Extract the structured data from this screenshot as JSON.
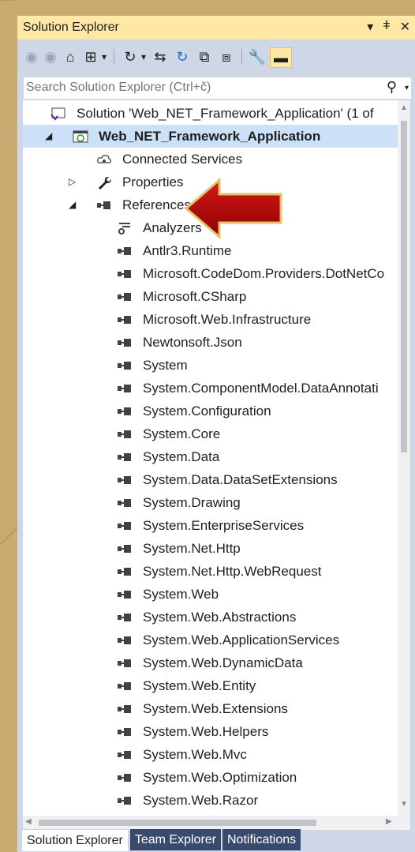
{
  "panel": {
    "title": "Solution Explorer",
    "pin_glyph": "▾",
    "autohide_glyph": "ǂ",
    "close_glyph": "✕"
  },
  "toolbar": {
    "back_glyph": "◉",
    "forward_glyph": "◉",
    "home_glyph": "⌂",
    "switch_views_glyph": "⊞",
    "dropdown_glyph": "▾",
    "history_glyph": "↻",
    "sync_glyph": "⇆",
    "refresh_glyph": "↻",
    "collapse_glyph": "⧉",
    "show_all_glyph": "⧈",
    "properties_glyph": "🔧",
    "preview_glyph": "▬"
  },
  "search": {
    "placeholder": "Search Solution Explorer (Ctrl+č)",
    "icon_glyph": "⚲",
    "dropdown_glyph": "▾"
  },
  "tree": [
    {
      "label": "Solution 'Web_NET_Framework_Application' (1 of",
      "icon": "solution-icon",
      "expander": ""
    },
    {
      "label": "Web_NET_Framework_Application",
      "icon": "web-project-icon",
      "expander": "◢",
      "bold": true
    },
    {
      "label": "Connected Services",
      "icon": "connected-services-icon",
      "expander": ""
    },
    {
      "label": "Properties",
      "icon": "wrench-icon",
      "expander": "▷"
    },
    {
      "label": "References",
      "icon": "reference-icon",
      "expander": "◢"
    },
    {
      "label": "Analyzers",
      "icon": "analyzer-icon",
      "expander": ""
    },
    {
      "label": "Antlr3.Runtime",
      "icon": "reference-icon"
    },
    {
      "label": "Microsoft.CodeDom.Providers.DotNetCo",
      "icon": "reference-icon"
    },
    {
      "label": "Microsoft.CSharp",
      "icon": "reference-icon"
    },
    {
      "label": "Microsoft.Web.Infrastructure",
      "icon": "reference-icon"
    },
    {
      "label": "Newtonsoft.Json",
      "icon": "reference-icon"
    },
    {
      "label": "System",
      "icon": "reference-icon"
    },
    {
      "label": "System.ComponentModel.DataAnnotati",
      "icon": "reference-icon"
    },
    {
      "label": "System.Configuration",
      "icon": "reference-icon"
    },
    {
      "label": "System.Core",
      "icon": "reference-icon"
    },
    {
      "label": "System.Data",
      "icon": "reference-icon"
    },
    {
      "label": "System.Data.DataSetExtensions",
      "icon": "reference-icon"
    },
    {
      "label": "System.Drawing",
      "icon": "reference-icon"
    },
    {
      "label": "System.EnterpriseServices",
      "icon": "reference-icon"
    },
    {
      "label": "System.Net.Http",
      "icon": "reference-icon"
    },
    {
      "label": "System.Net.Http.WebRequest",
      "icon": "reference-icon"
    },
    {
      "label": "System.Web",
      "icon": "reference-icon"
    },
    {
      "label": "System.Web.Abstractions",
      "icon": "reference-icon"
    },
    {
      "label": "System.Web.ApplicationServices",
      "icon": "reference-icon"
    },
    {
      "label": "System.Web.DynamicData",
      "icon": "reference-icon"
    },
    {
      "label": "System.Web.Entity",
      "icon": "reference-icon"
    },
    {
      "label": "System.Web.Extensions",
      "icon": "reference-icon"
    },
    {
      "label": "System.Web.Helpers",
      "icon": "reference-icon"
    },
    {
      "label": "System.Web.Mvc",
      "icon": "reference-icon"
    },
    {
      "label": "System.Web.Optimization",
      "icon": "reference-icon"
    },
    {
      "label": "System.Web.Razor",
      "icon": "reference-icon"
    }
  ],
  "scroll": {
    "up": "▲",
    "down": "▼",
    "left": "◀",
    "right": "▶"
  },
  "tabs": [
    {
      "label": "Solution Explorer",
      "active": true
    },
    {
      "label": "Team Explorer",
      "active": false
    },
    {
      "label": "Notifications",
      "active": false
    }
  ],
  "colors": {
    "selection": "#cce0f7",
    "title_bar": "#ffe8a6",
    "chrome": "#cfd6e5",
    "arrow": "#b30000"
  }
}
